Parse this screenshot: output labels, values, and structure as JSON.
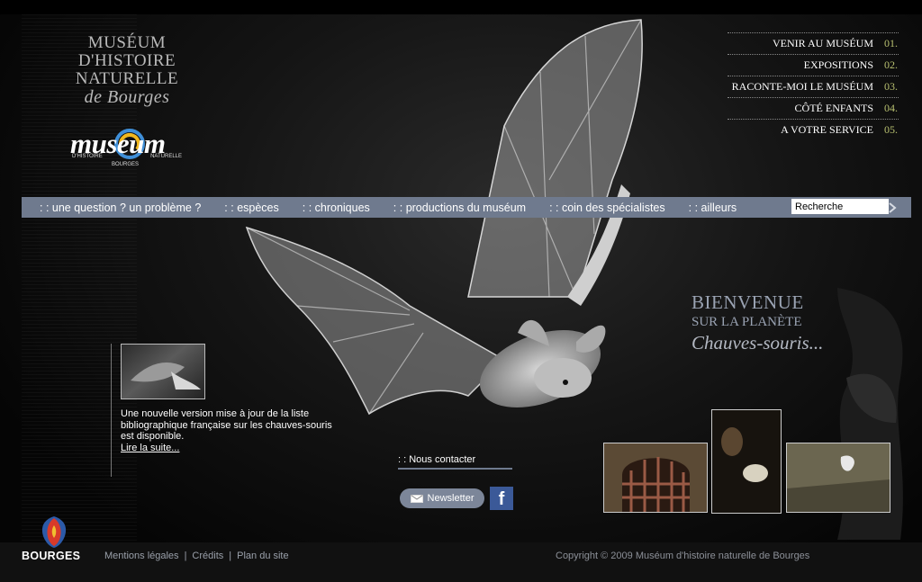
{
  "brand": {
    "title_lines": [
      "MUSÉUM",
      "D'HISTOIRE",
      "NATURELLE"
    ],
    "title_italic": "de Bourges",
    "logo_word": "museum",
    "logo_sub_left": "D'HISTOIRE",
    "logo_sub_right": "NATURELLE",
    "logo_bourges": "BOURGES"
  },
  "top_nav": [
    {
      "label": "VENIR AU MUSÉUM",
      "num": "01."
    },
    {
      "label": "EXPOSITIONS",
      "num": "02."
    },
    {
      "label": "RACONTE-MOI LE MUSÉUM",
      "num": "03."
    },
    {
      "label": "CÔTÉ ENFANTS",
      "num": "04."
    },
    {
      "label": "A VOTRE SERVICE",
      "num": "05."
    }
  ],
  "main_nav": [
    ": : une question ? un problème ?",
    ": : espèces",
    ": : chroniques",
    ": : productions du muséum",
    ": : coin des spécialistes",
    ": : ailleurs"
  ],
  "search": {
    "value": "Recherche",
    "button_icon": "chevron-right-icon"
  },
  "welcome": {
    "line1": "BIENVENUE",
    "line2": "SUR LA PLANÈTE",
    "line3": "Chauves-souris..."
  },
  "news": {
    "text": "Une nouvelle version mise à jour de la liste bibliographique française sur les chauves-souris est disponible.",
    "link": "Lire la suite..."
  },
  "contact": {
    "label": ": : Nous contacter",
    "newsletter": "Newsletter",
    "facebook": "f"
  },
  "footer": {
    "city": "BOURGES",
    "links": [
      "Mentions légales",
      "Crédits",
      "Plan du site"
    ],
    "separator": "|",
    "copyright": "Copyright © 2009 Muséum d'histoire naturelle de Bourges"
  },
  "colors": {
    "nav_bar": "#6f7a8e",
    "accent_num": "#b8c070",
    "welcome": "#9aa3b3"
  }
}
